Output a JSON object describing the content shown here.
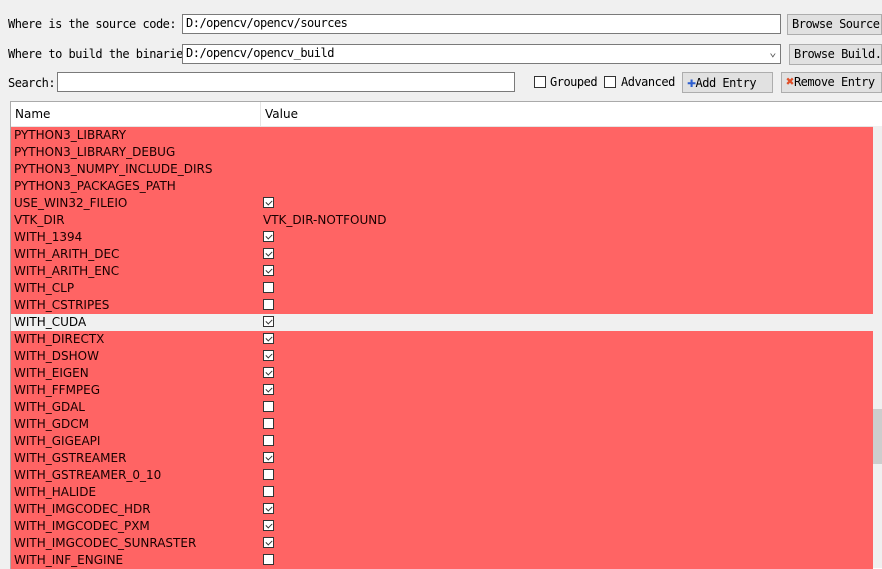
{
  "source": {
    "label": "Where is the source code:",
    "value": "D:/opencv/opencv/sources",
    "browse": "Browse Source..."
  },
  "build": {
    "label": "Where to build the binaries:",
    "value": "D:/opencv/opencv_build",
    "browse": "Browse Build..."
  },
  "search": {
    "label": "Search:",
    "value": ""
  },
  "options": {
    "grouped": "Grouped",
    "advanced": "Advanced",
    "grouped_checked": false,
    "advanced_checked": false
  },
  "buttons": {
    "add": "Add Entry",
    "remove": "Remove Entry"
  },
  "table": {
    "columns": [
      "Name",
      "Value"
    ],
    "rows": [
      {
        "name": "PYTHON3_LIBRARY",
        "value": ""
      },
      {
        "name": "PYTHON3_LIBRARY_DEBUG",
        "value": ""
      },
      {
        "name": "PYTHON3_NUMPY_INCLUDE_DIRS",
        "value": ""
      },
      {
        "name": "PYTHON3_PACKAGES_PATH",
        "value": ""
      },
      {
        "name": "USE_WIN32_FILEIO",
        "check": true
      },
      {
        "name": "VTK_DIR",
        "value": "VTK_DIR-NOTFOUND"
      },
      {
        "name": "WITH_1394",
        "check": true
      },
      {
        "name": "WITH_ARITH_DEC",
        "check": true
      },
      {
        "name": "WITH_ARITH_ENC",
        "check": true
      },
      {
        "name": "WITH_CLP",
        "check": false
      },
      {
        "name": "WITH_CSTRIPES",
        "check": false
      },
      {
        "name": "WITH_CUDA",
        "check": true,
        "selected": true
      },
      {
        "name": "WITH_DIRECTX",
        "check": true
      },
      {
        "name": "WITH_DSHOW",
        "check": true
      },
      {
        "name": "WITH_EIGEN",
        "check": true
      },
      {
        "name": "WITH_FFMPEG",
        "check": true
      },
      {
        "name": "WITH_GDAL",
        "check": false
      },
      {
        "name": "WITH_GDCM",
        "check": false
      },
      {
        "name": "WITH_GIGEAPI",
        "check": false
      },
      {
        "name": "WITH_GSTREAMER",
        "check": true
      },
      {
        "name": "WITH_GSTREAMER_0_10",
        "check": false
      },
      {
        "name": "WITH_HALIDE",
        "check": false
      },
      {
        "name": "WITH_IMGCODEC_HDR",
        "check": true
      },
      {
        "name": "WITH_IMGCODEC_PXM",
        "check": true
      },
      {
        "name": "WITH_IMGCODEC_SUNRASTER",
        "check": true
      },
      {
        "name": "WITH_INF_ENGINE",
        "check": false
      }
    ]
  },
  "colors": {
    "new_entry": "#ff6464",
    "selected": "#f0f0f0"
  }
}
